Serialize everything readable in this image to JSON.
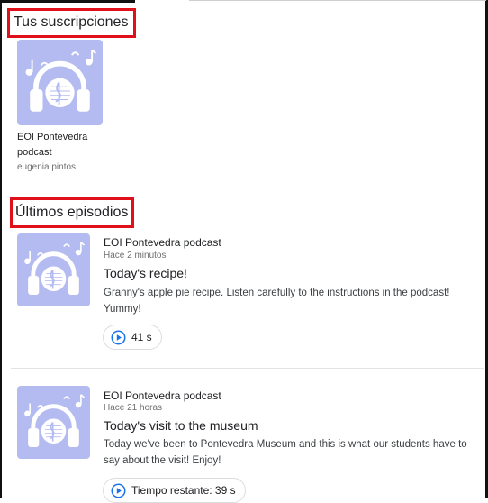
{
  "subscriptions": {
    "heading": "Tus suscripciones",
    "items": [
      {
        "name_line1": "EOI Pontevedra",
        "name_line2": "podcast",
        "author": "eugenia pintos"
      }
    ]
  },
  "episodes": {
    "heading": "Últimos episodios",
    "items": [
      {
        "show": "EOI Pontevedra podcast",
        "time_ago": "Hace 2 minutos",
        "title": "Today's recipe!",
        "desc_line1": "Granny's apple pie recipe. Listen carefully to the instructions in the podcast!",
        "desc_line2": "Yummy!",
        "play_label": "41 s"
      },
      {
        "show": "EOI Pontevedra podcast",
        "time_ago": "Hace 21 horas",
        "title": "Today's visit to the museum",
        "desc_line1": "Today we've been to Pontevedra Museum and this is what our students have to",
        "desc_line2": "say about the visit! Enjoy!",
        "play_label": "Tiempo restante: 39 s"
      }
    ]
  },
  "colors": {
    "artwork_bg": "#b3bbf1",
    "artwork_fg": "#ffffff",
    "highlight": "#e0101b",
    "play_accent": "#1a73e8"
  },
  "icons": {
    "artwork": "headphones-music-note-icon",
    "play": "play-circle-icon"
  }
}
